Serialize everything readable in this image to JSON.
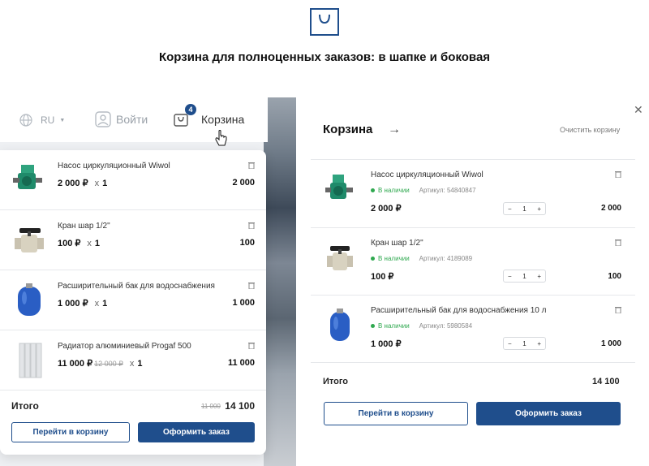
{
  "headline": "Корзина для полноценных заказов: в шапке и боковая",
  "header": {
    "lang": "RU",
    "login": "Войти",
    "cart": "Корзина",
    "cart_count": "4"
  },
  "dropdown": {
    "items": [
      {
        "name": "Насос циркуляционный Wiwol",
        "price": "2 000 ₽",
        "old": "",
        "qty": "1",
        "total": "2 000"
      },
      {
        "name": "Кран шар 1/2\"",
        "price": "100 ₽",
        "old": "",
        "qty": "1",
        "total": "100"
      },
      {
        "name": "Расширительный бак для водоснабжения",
        "price": "1 000 ₽",
        "old": "",
        "qty": "1",
        "total": "1 000"
      },
      {
        "name": "Радиатор алюминиевый Progaf 500",
        "price": "11 000 ₽",
        "old": "12 000 ₽",
        "qty": "1",
        "total": "11 000"
      }
    ],
    "sum_label": "Итого",
    "sum_old": "11 000",
    "sum": "14 100",
    "go_cart": "Перейти в корзину",
    "checkout": "Оформить заказ",
    "x": "x"
  },
  "side": {
    "title": "Корзина",
    "arrow": "→",
    "clear": "Очистить корзину",
    "close": "✕",
    "items": [
      {
        "name": "Насос циркуляционный Wiwol",
        "stock": "В наличии",
        "sku": "Артикул: 54840847",
        "price": "2 000 ₽",
        "qty": "1",
        "total": "2 000"
      },
      {
        "name": "Кран шар 1/2\"",
        "stock": "В наличии",
        "sku": "Артикул: 4189089",
        "price": "100 ₽",
        "qty": "1",
        "total": "100"
      },
      {
        "name": "Расширительный бак для водоснабжения 10 л",
        "stock": "В наличии",
        "sku": "Артикул: 5980584",
        "price": "1 000 ₽",
        "qty": "1",
        "total": "1 000"
      }
    ],
    "sum_label": "Итого",
    "sum": "14 100",
    "go_cart": "Перейти в корзину",
    "checkout": "Оформить заказ",
    "minus": "−",
    "plus": "+"
  },
  "colors": {
    "accent": "#1f4e8c",
    "stock": "#2fa84f"
  }
}
